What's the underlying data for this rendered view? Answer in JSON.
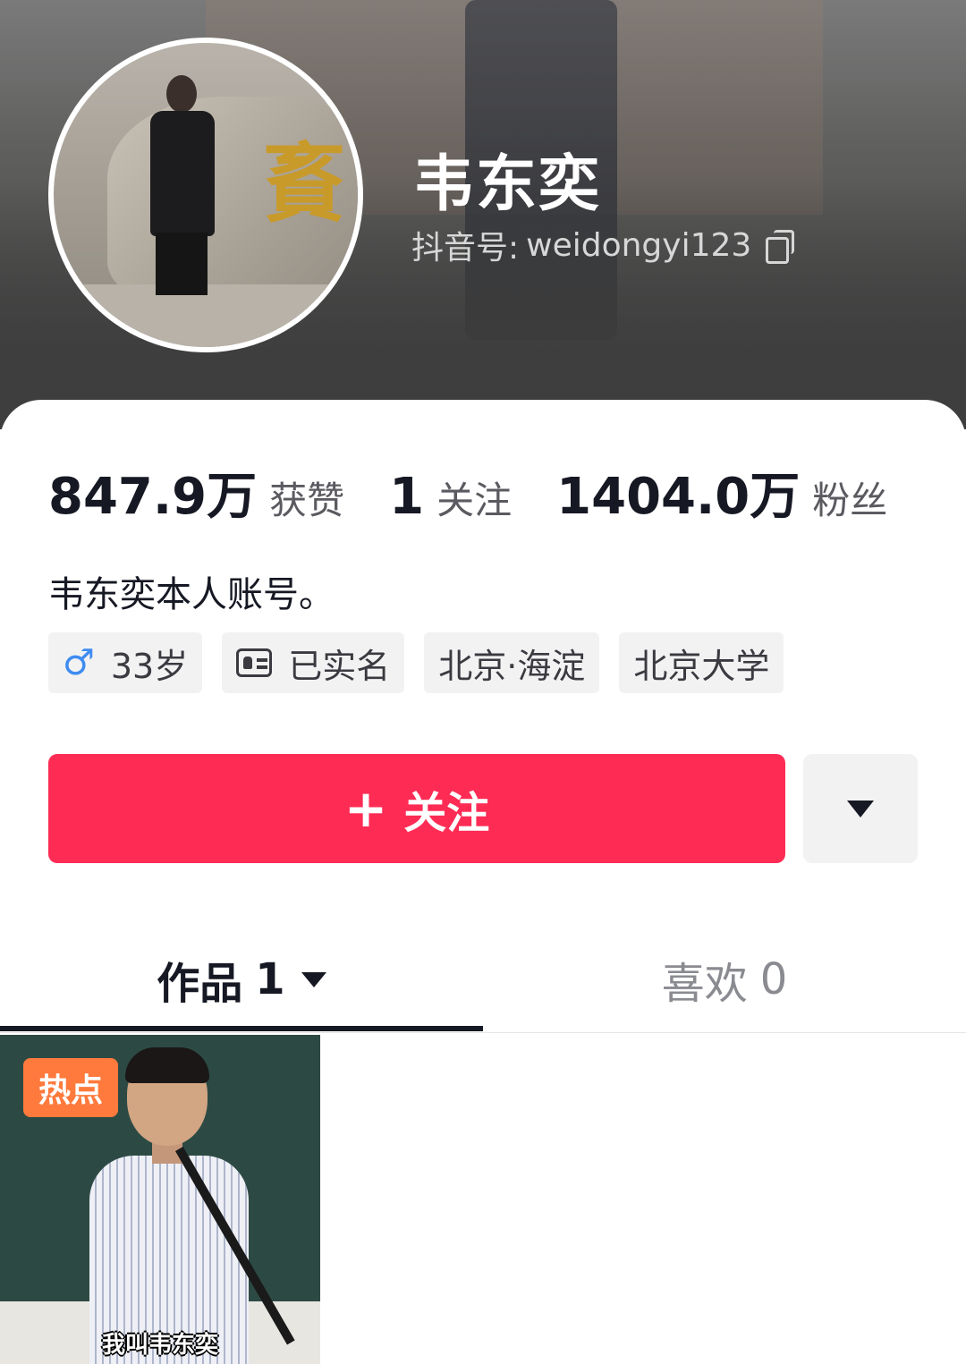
{
  "profile": {
    "name": "韦东奕",
    "douyin_id_label": "抖音号:",
    "douyin_id": "weidongyi123",
    "bio": "韦东奕本人账号。"
  },
  "stats": [
    {
      "value": "847.9万",
      "label": "获赞"
    },
    {
      "value": "1",
      "label": "关注"
    },
    {
      "value": "1404.0万",
      "label": "粉丝"
    }
  ],
  "tags": {
    "age": "33岁",
    "verified": "已实名",
    "location": "北京·海淀",
    "school": "北京大学"
  },
  "actions": {
    "follow_label": "关注",
    "more_icon": "caret-down-icon"
  },
  "tabs": {
    "works_label": "作品",
    "works_count": "1",
    "likes_label": "喜欢",
    "likes_count": "0"
  },
  "videos": [
    {
      "badge": "热点",
      "caption": "我叫韦东奕"
    }
  ],
  "colors": {
    "accent": "#fe2c55",
    "badge": "#ff7a3c",
    "male_icon": "#3f8cf0"
  }
}
